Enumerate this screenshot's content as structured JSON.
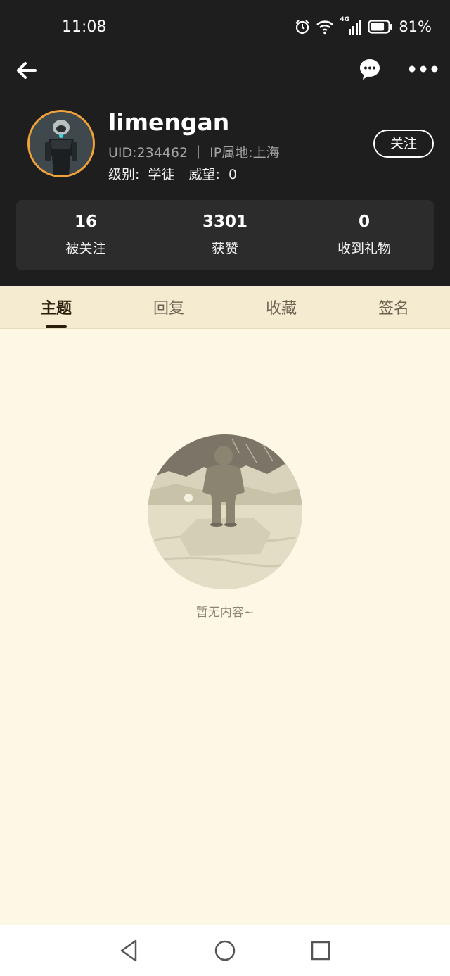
{
  "status_bar": {
    "time": "11:08",
    "network": "4G",
    "battery_percent": "81%",
    "battery_level": 0.81
  },
  "profile": {
    "username": "limengan",
    "uid_ip": "UID:234462 ｜ IP属地:上海",
    "level_label": "级别:",
    "level_value": "学徒",
    "prestige_label": "威望:",
    "prestige_value": "0",
    "follow_label": "关注"
  },
  "stats": [
    {
      "value": "16",
      "label": "被关注"
    },
    {
      "value": "3301",
      "label": "获赞"
    },
    {
      "value": "0",
      "label": "收到礼物"
    }
  ],
  "tabs": [
    {
      "label": "主题",
      "active": true
    },
    {
      "label": "回复",
      "active": false
    },
    {
      "label": "收藏",
      "active": false
    },
    {
      "label": "签名",
      "active": false
    }
  ],
  "empty": {
    "text": "暂无内容~"
  },
  "icons": {
    "back": "arrow-left-icon",
    "chat": "chat-bubble-icon",
    "more": "more-dots-icon",
    "nav_back": "triangle-back-icon",
    "nav_home": "circle-home-icon",
    "nav_recent": "square-recent-icon"
  },
  "colors": {
    "header_bg": "#1e1e1e",
    "stats_bg": "#2c2c2c",
    "page_bg": "#fdf7e5",
    "tabs_bg": "#f4ebd0",
    "avatar_ring": "#f0a23a"
  }
}
